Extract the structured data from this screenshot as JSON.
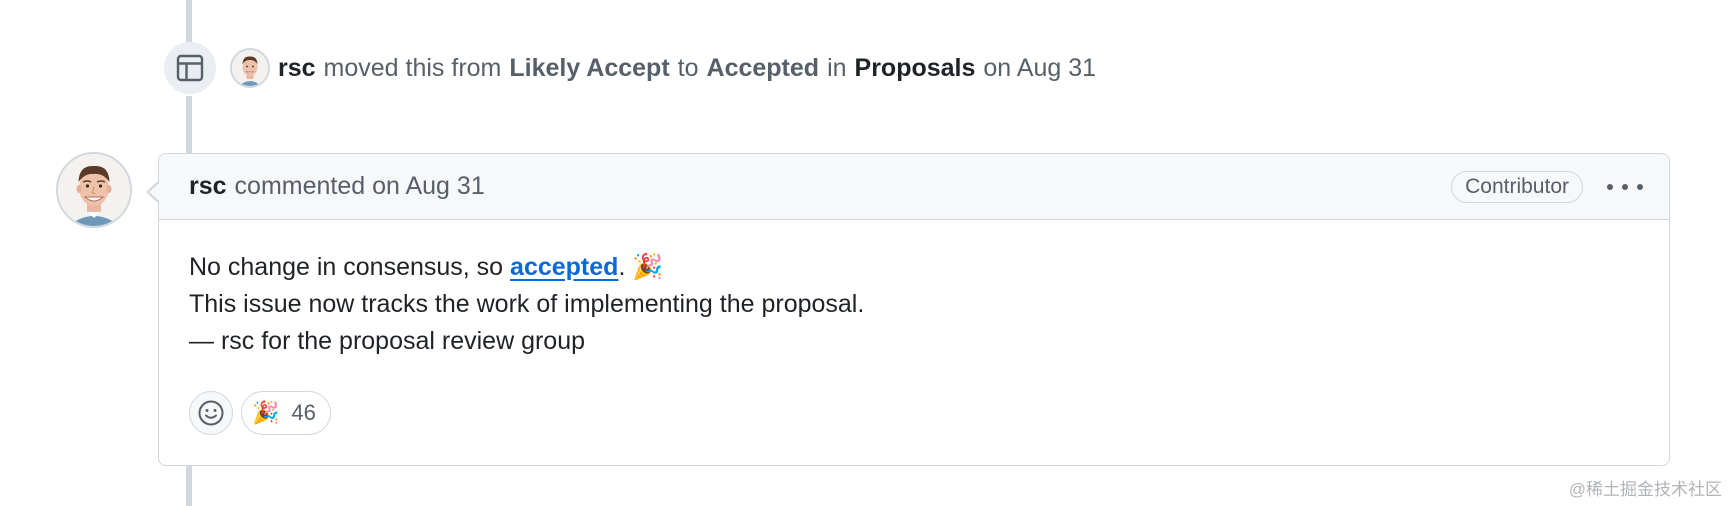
{
  "timeline_event": {
    "actor": "rsc",
    "action_text": "moved this from",
    "from_column": "Likely Accept",
    "to_text": "to",
    "to_column": "Accepted",
    "in_text": "in",
    "project": "Proposals",
    "date": "on Aug 31",
    "icon": "project-table-icon"
  },
  "comment": {
    "author": "rsc",
    "meta": "commented on Aug 31",
    "badge": "Contributor",
    "menu_icon": "kebab-horizontal-icon",
    "body": {
      "line1_prefix": "No change in consensus, so ",
      "line1_link": "accepted",
      "line1_suffix": ".",
      "line1_emoji": "🎉",
      "line2": "This issue now tracks the work of implementing the proposal.",
      "line3": "— rsc for the proposal review group"
    },
    "reactions": {
      "add_icon": "smiley-icon",
      "items": [
        {
          "emoji": "🎉",
          "count": "46"
        }
      ]
    }
  },
  "watermark": "@稀土掘金技术社区",
  "colors": {
    "link": "#0969da",
    "border": "#d0d7de",
    "header_bg": "#f6f8fa",
    "muted_text": "#57606a"
  }
}
